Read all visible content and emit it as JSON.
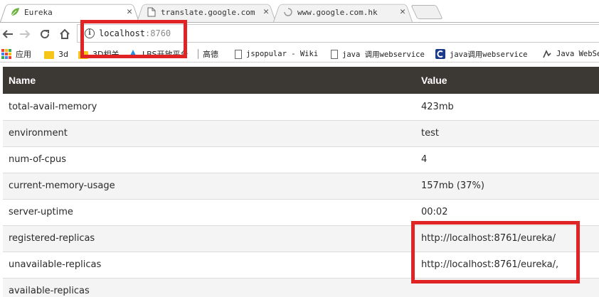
{
  "tabs": [
    {
      "label": "Eureka",
      "active": true
    },
    {
      "label": "translate.google.com",
      "active": false
    },
    {
      "label": "www.google.com.hk",
      "active": false
    }
  ],
  "address": {
    "host": "localhost",
    "port": ":8760"
  },
  "bookmarks": [
    {
      "label": "应用"
    },
    {
      "label": "3d"
    },
    {
      "label": "3D相关"
    },
    {
      "label": "LBS开放平台"
    },
    {
      "label": "高德"
    },
    {
      "label": "jspopular - Wiki"
    },
    {
      "label": "java 调用webservice"
    },
    {
      "label": "java调用webservice"
    },
    {
      "label": "Java WebSe"
    }
  ],
  "table": {
    "headers": [
      "Name",
      "Value"
    ],
    "rows": [
      {
        "name": "total-avail-memory",
        "value": "423mb"
      },
      {
        "name": "environment",
        "value": "test"
      },
      {
        "name": "num-of-cpus",
        "value": "4"
      },
      {
        "name": "current-memory-usage",
        "value": "157mb (37%)"
      },
      {
        "name": "server-uptime",
        "value": "00:02"
      },
      {
        "name": "registered-replicas",
        "value": "http://localhost:8761/eureka/"
      },
      {
        "name": "unavailable-replicas",
        "value": "http://localhost:8761/eureka/,"
      },
      {
        "name": "available-replicas",
        "value": ""
      }
    ]
  },
  "colors": {
    "header_bg": "#3c3834",
    "highlight": "#e02426",
    "spring_green": "#6db33f"
  }
}
